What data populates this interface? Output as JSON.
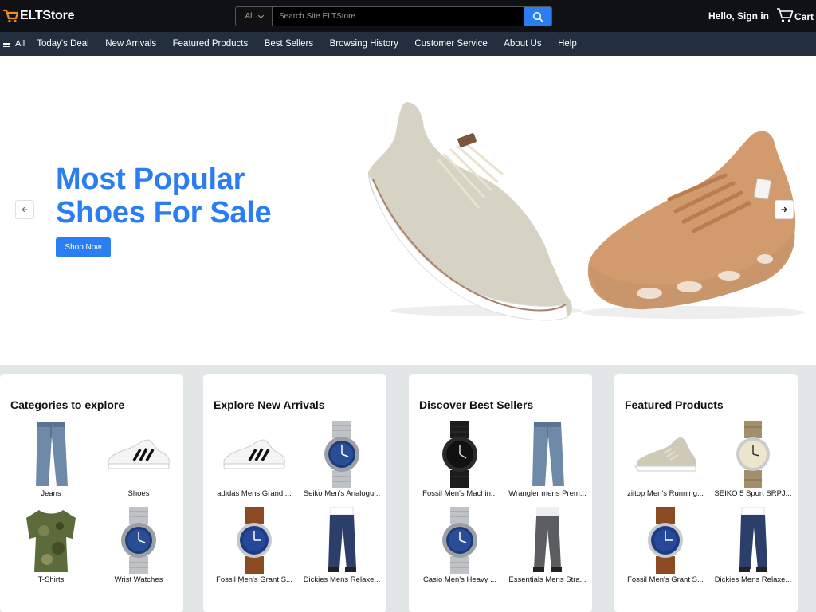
{
  "header": {
    "logo_text": "ELTStore",
    "search": {
      "category": "All",
      "placeholder": "Search Site ELTStore"
    },
    "signin": "Hello, Sign in",
    "cart_label": "Cart"
  },
  "nav": {
    "all_label": "All",
    "items": [
      "Today's Deal",
      "New Arrivals",
      "Featured Products",
      "Best Sellers",
      "Browsing History",
      "Customer Service",
      "About Us",
      "Help"
    ]
  },
  "hero": {
    "title_line1": "Most Popular",
    "title_line2": "Shoes For Sale",
    "cta": "Shop Now"
  },
  "cards": [
    {
      "title": "Categories to explore",
      "items": [
        {
          "label": "Jeans",
          "icon": "jeans"
        },
        {
          "label": "Shoes",
          "icon": "sneaker-white"
        },
        {
          "label": "T-Shirts",
          "icon": "tshirt"
        },
        {
          "label": "Wrist Watches",
          "icon": "watch-steel"
        }
      ]
    },
    {
      "title": "Explore New Arrivals",
      "items": [
        {
          "label": "adidas Mens Grand ...",
          "icon": "sneaker-white"
        },
        {
          "label": "Seiko Men's Analogu...",
          "icon": "watch-steel"
        },
        {
          "label": "Fossil Men's Grant S...",
          "icon": "watch-leather"
        },
        {
          "label": "Dickies Mens Relaxe...",
          "icon": "jeans-dark"
        }
      ]
    },
    {
      "title": "Discover Best Sellers",
      "items": [
        {
          "label": "Fossil Men's Machin...",
          "icon": "watch-black"
        },
        {
          "label": "Wrangler mens Prem...",
          "icon": "jeans"
        },
        {
          "label": "Casio Men's Heavy ...",
          "icon": "watch-steel"
        },
        {
          "label": "Essentials Mens Stra...",
          "icon": "pants-grey"
        }
      ]
    },
    {
      "title": "Featured Products",
      "items": [
        {
          "label": "ziitop Men's Running...",
          "icon": "sneaker-beige"
        },
        {
          "label": "SEIKO 5 Sport SRPJ...",
          "icon": "watch-field"
        },
        {
          "label": "Fossil Men's Grant S...",
          "icon": "watch-leather"
        },
        {
          "label": "Dickies Mens Relaxe...",
          "icon": "jeans-dark"
        }
      ]
    }
  ]
}
